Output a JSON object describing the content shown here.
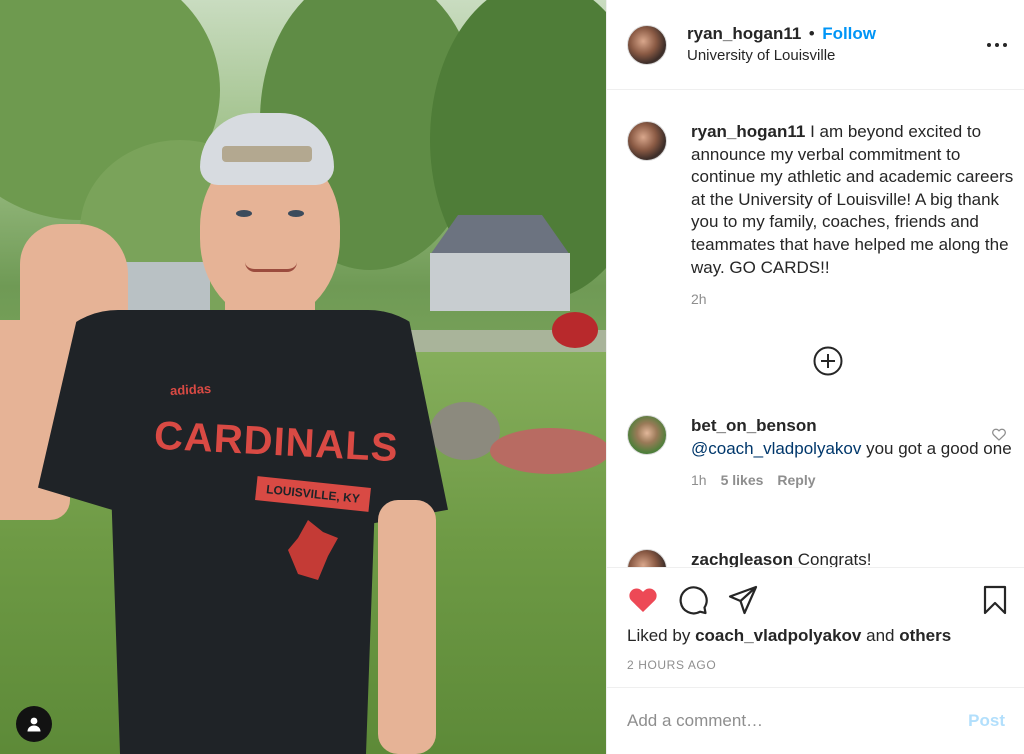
{
  "post_owner": {
    "username": "ryan_hogan11",
    "follow_label": "Follow",
    "separator": "•",
    "location": "University of Louisville"
  },
  "caption": {
    "username": "ryan_hogan11",
    "text": "I am beyond excited to announce my verbal commitment to continue my athletic and academic careers at the University of Louisville! A big thank you to my family, coaches, friends and teammates that have helped me along the way. GO CARDS!!",
    "time": "2h"
  },
  "comments": [
    {
      "username": "bet_on_benson",
      "mention": "@coach_vladpolyakov",
      "text": "you got a good one",
      "time": "1h",
      "likes": "5 likes",
      "reply_label": "Reply"
    },
    {
      "username": "zachgleason",
      "text": "Congrats!"
    }
  ],
  "likes": {
    "prefix": "Liked by",
    "user": "coach_vladpolyakov",
    "joiner": "and",
    "others": "others"
  },
  "timestamp": "2 HOURS AGO",
  "add_comment": {
    "placeholder": "Add a comment…",
    "post_label": "Post"
  },
  "photo": {
    "shirt_text_main": "CARDINALS",
    "shirt_text_sub": "LOUISVILLE, KY",
    "shirt_brand": "adidas"
  },
  "colors": {
    "like_red": "#ed4956",
    "follow_blue": "#0095f6",
    "post_disabled": "#b2dffc",
    "muted": "#8e8e8e"
  },
  "icons": {
    "like": "heart-icon",
    "comment": "comment-icon",
    "share": "share-icon",
    "save": "bookmark-icon",
    "load_more": "plus-circle-icon",
    "more": "more-icon",
    "user_tag": "user-icon"
  }
}
